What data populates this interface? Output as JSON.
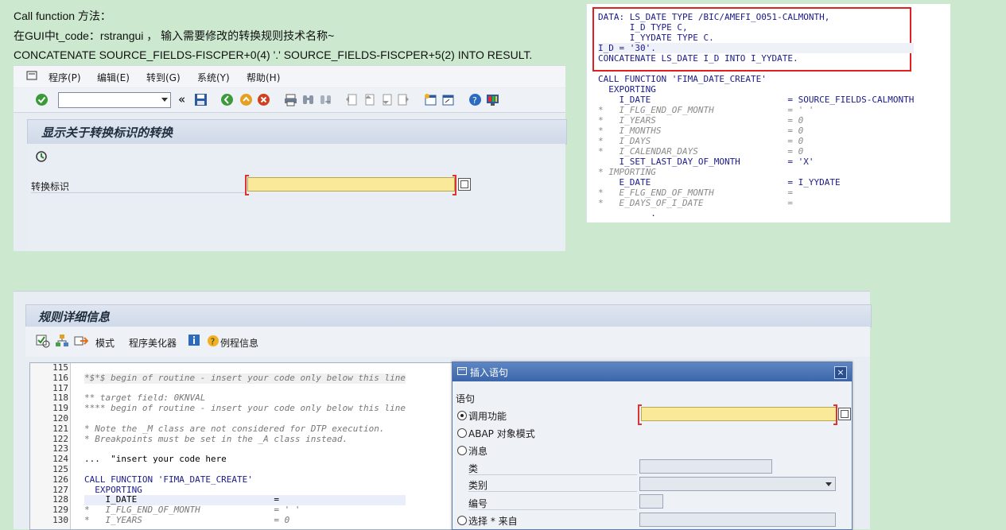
{
  "intro": {
    "line1": "Call function 方法：",
    "line2": "在GUI中t_code：rstrangui ，  输入需要修改的转换规则技术名称~",
    "line3": "CONCATENATE SOURCE_FIELDS-FISCPER+0(4) '.' SOURCE_FIELDS-FISCPER+5(2) INTO RESULT."
  },
  "gui1": {
    "menu": [
      "程序(P)",
      "编辑(E)",
      "转到(G)",
      "系统(Y)",
      "帮助(H)"
    ],
    "title": "显示关于转换标识的转换",
    "field_label": "转换标识",
    "double_arrow": "«"
  },
  "code_snippet": {
    "lines": [
      {
        "text": "DATA: LS_DATE TYPE /BIC/AMEFI_O051-CALMONTH,",
        "kind": "code"
      },
      {
        "text": "      I_D TYPE C,",
        "kind": "code"
      },
      {
        "text": "      I_YYDATE TYPE C.",
        "kind": "code"
      },
      {
        "text": "I_D = '30'.",
        "kind": "code"
      },
      {
        "text": "CONCATENATE LS_DATE I_D INTO I_YYDATE.",
        "kind": "code"
      },
      {
        "text": "",
        "kind": "code"
      },
      {
        "text": "CALL FUNCTION 'FIMA_DATE_CREATE'",
        "kind": "code"
      },
      {
        "text": "  EXPORTING",
        "kind": "code"
      },
      {
        "text": "    I_DATE                          = SOURCE_FIELDS-CALMONTH",
        "kind": "code"
      },
      {
        "text": "*   I_FLG_END_OF_MONTH              = ' '",
        "kind": "comment"
      },
      {
        "text": "*   I_YEARS                         = 0",
        "kind": "comment"
      },
      {
        "text": "*   I_MONTHS                        = 0",
        "kind": "comment"
      },
      {
        "text": "*   I_DAYS                          = 0",
        "kind": "comment"
      },
      {
        "text": "*   I_CALENDAR_DAYS                 = 0",
        "kind": "comment"
      },
      {
        "text": "    I_SET_LAST_DAY_OF_MONTH         = 'X'",
        "kind": "code"
      },
      {
        "text": "* IMPORTING",
        "kind": "comment"
      },
      {
        "text": "    E_DATE                          = I_YYDATE",
        "kind": "code"
      },
      {
        "text": "*   E_FLG_END_OF_MONTH              =",
        "kind": "comment"
      },
      {
        "text": "*   E_DAYS_OF_I_DATE                =",
        "kind": "comment"
      },
      {
        "text": "          .",
        "kind": "code"
      }
    ]
  },
  "gui2": {
    "title": "规则详细信息",
    "toolbar": {
      "mode": "模式",
      "pretty_printer": "程序美化器",
      "example": "例程信息"
    },
    "line_numbers": [
      "115",
      "116",
      "117",
      "118",
      "119",
      "120",
      "121",
      "122",
      "123",
      "124",
      "125",
      "126",
      "127",
      "128",
      "129",
      "130"
    ],
    "code_lines": [
      "",
      "*$*$ begin of routine - insert your code only below this line",
      "",
      "** target field: 0KNVAL",
      "**** begin of routine - insert your code only below this line",
      "",
      "* Note the _M class are not considered for DTP execution.",
      "* Breakpoints must be set in the _A class instead.",
      "",
      "...  \"insert your code here",
      "",
      "CALL FUNCTION 'FIMA_DATE_CREATE'",
      "  EXPORTING",
      "    I_DATE                          =",
      "*   I_FLG_END_OF_MONTH              = ' '",
      "*   I_YEARS                         = 0"
    ]
  },
  "dialog": {
    "title": "插入语句",
    "group_label": "语句",
    "options": [
      "调用功能",
      "ABAP 对象模式",
      "消息",
      "选择 * 来自"
    ],
    "fields": [
      "类",
      "类别",
      "编号"
    ]
  }
}
